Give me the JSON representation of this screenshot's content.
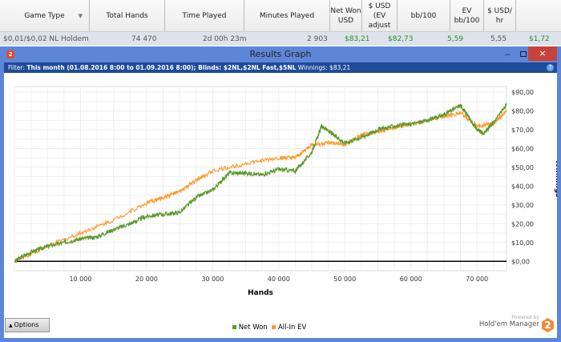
{
  "table": {
    "headers": [
      "Game Type",
      "Total Hands",
      "Time Played",
      "Minutes Played",
      "Net Won USD",
      "$ USD (EV adjust",
      "bb/100",
      "EV bb/100",
      "$ USD/ hr"
    ],
    "row": [
      "$0,01/$0,02 NL Holdem",
      "74 470",
      "2d 00h 23m",
      "2 903",
      "$83,21",
      "$82,73",
      "5,59",
      "5,55",
      "$1,72"
    ]
  },
  "window": {
    "title": "Results Graph",
    "badge": "2",
    "filter_label": "Filter:",
    "filter_text": "This month (01.08.2016 8:00 to 01.09.2016 8:00); Blinds: $2NL,$2NL Fast,$5NL",
    "winnings": "Winnings: $83,21",
    "help": "?",
    "close": "×"
  },
  "options_label": "Options",
  "powered_by": "Powered by",
  "brand": "Hold'em Manager",
  "brand_badge": "2",
  "colors": {
    "net_won": "#5a9a2e",
    "all_in_ev": "#ff9a2e",
    "title_bar": "#5e86d8",
    "filter_bar": "#1e4b9a"
  },
  "chart_data": {
    "type": "line",
    "xlabel": "Hands",
    "ylabel": "Winnings",
    "xlim": [
      0,
      74470
    ],
    "ylim": [
      -5,
      93
    ],
    "xticks": [
      "10 000",
      "20 000",
      "30 000",
      "40 000",
      "50 000",
      "60 000",
      "70 000"
    ],
    "xtick_values": [
      10000,
      20000,
      30000,
      40000,
      50000,
      60000,
      70000
    ],
    "yticks": [
      "$0,00",
      "$10,00",
      "$20,00",
      "$30,00",
      "$40,00",
      "$50,00",
      "$60,00",
      "$70,00",
      "$80,00",
      "$90,00"
    ],
    "ytick_values": [
      0,
      10,
      20,
      30,
      40,
      50,
      60,
      70,
      80,
      90
    ],
    "grid": true,
    "legend": "bottom",
    "series": [
      {
        "name": "Net Won",
        "x": [
          0,
          2500,
          5000,
          7500,
          10000,
          12500,
          15000,
          17500,
          20000,
          22500,
          25000,
          27500,
          30000,
          32500,
          35000,
          37500,
          40000,
          42500,
          45000,
          46500,
          48000,
          50000,
          52500,
          55000,
          57500,
          60000,
          62500,
          65000,
          67500,
          68500,
          70000,
          71000,
          72500,
          74470
        ],
        "y": [
          0,
          5,
          8,
          10,
          12,
          13,
          17,
          20,
          24,
          25,
          26,
          34,
          38,
          47,
          47,
          46,
          49,
          48,
          58,
          72,
          68,
          63,
          66,
          70,
          72,
          73,
          75,
          78,
          83,
          78,
          70,
          68,
          74,
          83
        ]
      },
      {
        "name": "All-In EV",
        "x": [
          0,
          5000,
          10000,
          15000,
          20000,
          22500,
          25000,
          27500,
          30000,
          35000,
          40000,
          42500,
          45000,
          47500,
          50000,
          52500,
          55000,
          57500,
          60000,
          65000,
          67500,
          70000,
          72500,
          74470
        ],
        "y": [
          0,
          8,
          15,
          22,
          31,
          34,
          37,
          43,
          48,
          52,
          55,
          55,
          62,
          63,
          62,
          67,
          69,
          71,
          73,
          77,
          79,
          72,
          73,
          80
        ]
      }
    ]
  }
}
